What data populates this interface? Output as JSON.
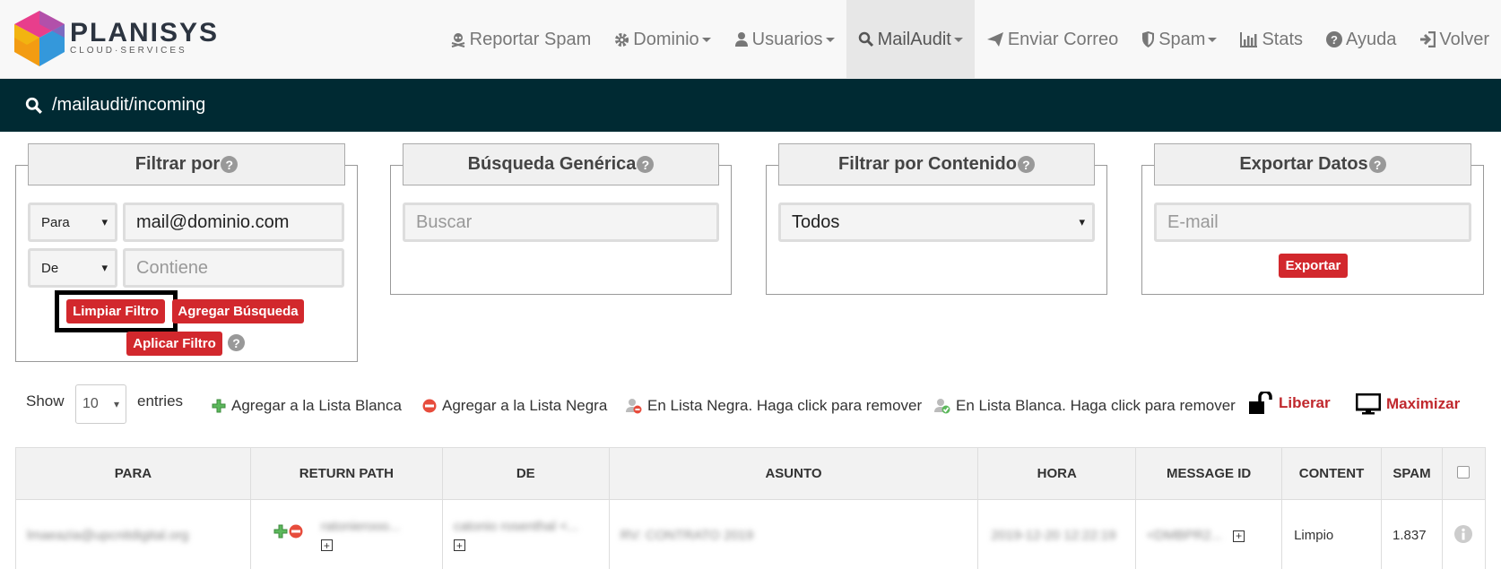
{
  "brand": {
    "name": "PLANISYS",
    "sub": "CLOUD·SERVICES"
  },
  "nav": {
    "reportar_spam": "Reportar Spam",
    "dominio": "Dominio",
    "usuarios": "Usuarios",
    "mailaudit": "MailAudit",
    "enviar_correo": "Enviar Correo",
    "spam": "Spam",
    "stats": "Stats",
    "ayuda": "Ayuda",
    "volver": "Volver"
  },
  "path": "/mailaudit/incoming",
  "filter": {
    "title": "Filtrar por",
    "help": "?",
    "row1_select": "Para",
    "row1_value": "mail@dominio.com",
    "row2_select": "De",
    "row2_placeholder": "Contiene",
    "btn_clear": "Limpiar Filtro",
    "btn_add": "Agregar Búsqueda",
    "btn_apply": "Aplicar Filtro"
  },
  "generic": {
    "title": "Búsqueda Genérica",
    "help": "?",
    "placeholder": "Buscar"
  },
  "content": {
    "title": "Filtrar por Contenido",
    "help": "?",
    "selected": "Todos"
  },
  "export": {
    "title": "Exportar Datos",
    "help": "?",
    "placeholder": "E-mail",
    "button": "Exportar"
  },
  "toolbar": {
    "show": "Show",
    "entries_value": "10",
    "entries": "entries",
    "whitelist_add": "Agregar a la Lista Blanca",
    "blacklist_add": "Agregar a la Lista Negra",
    "in_blacklist": "En Lista Negra. Haga click para remover",
    "in_whitelist": "En Lista Blanca. Haga click para remover",
    "liberar": "Liberar",
    "maximizar": "Maximizar"
  },
  "table": {
    "headers": [
      "PARA",
      "RETURN PATH",
      "DE",
      "ASUNTO",
      "HORA",
      "MESSAGE ID",
      "CONTENT",
      "SPAM"
    ],
    "row": {
      "para": "lmaeazia@upcnitdigital.org",
      "return_path": "ratonierooo...",
      "de": "catonio rosenthal <...",
      "asunto": "RV: CONTRATO 2019",
      "hora": "2019-12-20 12:22:19",
      "message_id": "<DMBPR2...",
      "content": "Limpio",
      "spam": "1.837"
    }
  },
  "colors": {
    "accent_red": "#d2282d",
    "pathbar": "#002a33"
  }
}
